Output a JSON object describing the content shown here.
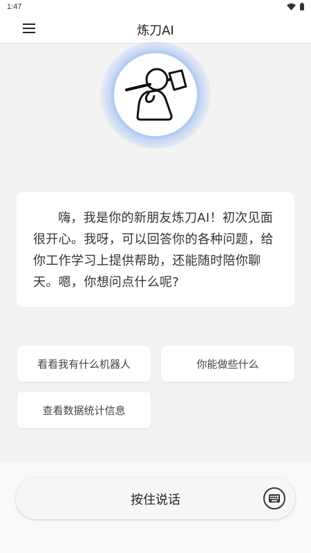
{
  "status_bar": {
    "time": "1:47",
    "icons": [
      "wifi-icon",
      "battery-icon"
    ]
  },
  "header": {
    "title": "炼刀AI",
    "menu_icon": "hamburger-menu-icon"
  },
  "avatar": {
    "icon": "robot-with-hammer-avatar",
    "halo_color": "#a9c8f3"
  },
  "message": {
    "text": "嗨，我是你的新朋友炼刀AI！初次见面很开心。我呀，可以回答你的各种问题，给你工作学习上提供帮助，还能随时陪你聊天。嗯，你想问点什么呢?"
  },
  "suggestions": [
    {
      "label": "看看我有什么机器人"
    },
    {
      "label": "你能做些什么"
    },
    {
      "label": "查看数据统计信息"
    }
  ],
  "input": {
    "voice_label": "按住说话",
    "keyboard_icon": "keyboard-icon"
  },
  "colors": {
    "background": "#f3f3f3",
    "card": "#ffffff",
    "text": "#333333"
  }
}
